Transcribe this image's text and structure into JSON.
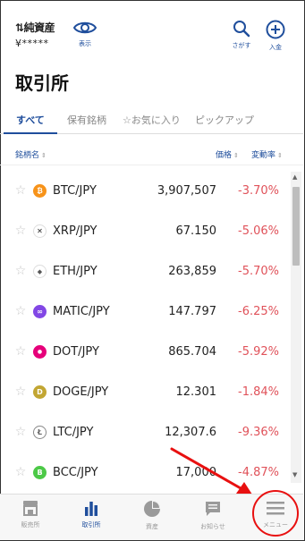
{
  "header": {
    "asset_title": "純資産",
    "asset_value": "¥*****",
    "show_label": "表示",
    "search_label": "さがす",
    "deposit_label": "入金"
  },
  "page_title": "取引所",
  "tabs": [
    {
      "label": "すべて",
      "active": true
    },
    {
      "label": "保有銘柄",
      "active": false
    },
    {
      "label": "☆お気に入り",
      "active": false
    },
    {
      "label": "ピックアップ",
      "active": false
    }
  ],
  "columns": {
    "name": "銘柄名",
    "price": "価格",
    "change": "変動率",
    "sort_glyph": "⇕"
  },
  "rows": [
    {
      "pair": "BTC/JPY",
      "price": "3,907,507",
      "change": "-3.70%",
      "icon": "bitcoin-icon",
      "icon_glyph": "₿",
      "color": "#f7931a"
    },
    {
      "pair": "XRP/JPY",
      "price": "67.150",
      "change": "-5.06%",
      "icon": "xrp-icon",
      "icon_glyph": "✕",
      "color": "#ffffff"
    },
    {
      "pair": "ETH/JPY",
      "price": "263,859",
      "change": "-5.70%",
      "icon": "ethereum-icon",
      "icon_glyph": "◆",
      "color": "#ffffff"
    },
    {
      "pair": "MATIC/JPY",
      "price": "147.797",
      "change": "-6.25%",
      "icon": "polygon-icon",
      "icon_glyph": "∞",
      "color": "#8247e5"
    },
    {
      "pair": "DOT/JPY",
      "price": "865.704",
      "change": "-5.92%",
      "icon": "polkadot-icon",
      "icon_glyph": "●",
      "color": "#e6007a"
    },
    {
      "pair": "DOGE/JPY",
      "price": "12.301",
      "change": "-1.84%",
      "icon": "dogecoin-icon",
      "icon_glyph": "D",
      "color": "#c2a633"
    },
    {
      "pair": "LTC/JPY",
      "price": "12,307.6",
      "change": "-9.36%",
      "icon": "litecoin-icon",
      "icon_glyph": "Ł",
      "color": "#ffffff"
    },
    {
      "pair": "BCC/JPY",
      "price": "17,000",
      "change": "-4.87%",
      "icon": "bitcoin-cash-icon",
      "icon_glyph": "B",
      "color": "#4cc947"
    }
  ],
  "bottom_nav": [
    {
      "label": "販売所",
      "icon": "store-icon",
      "active": false
    },
    {
      "label": "取引所",
      "icon": "bar-chart-icon",
      "active": true
    },
    {
      "label": "資産",
      "icon": "pie-chart-icon",
      "active": false
    },
    {
      "label": "お知らせ",
      "icon": "message-icon",
      "active": false
    },
    {
      "label": "メニュー",
      "icon": "hamburger-menu-icon",
      "active": false
    }
  ],
  "colors": {
    "accent": "#1f4e9c",
    "negative": "#e0525a",
    "annotation": "#e81010"
  }
}
